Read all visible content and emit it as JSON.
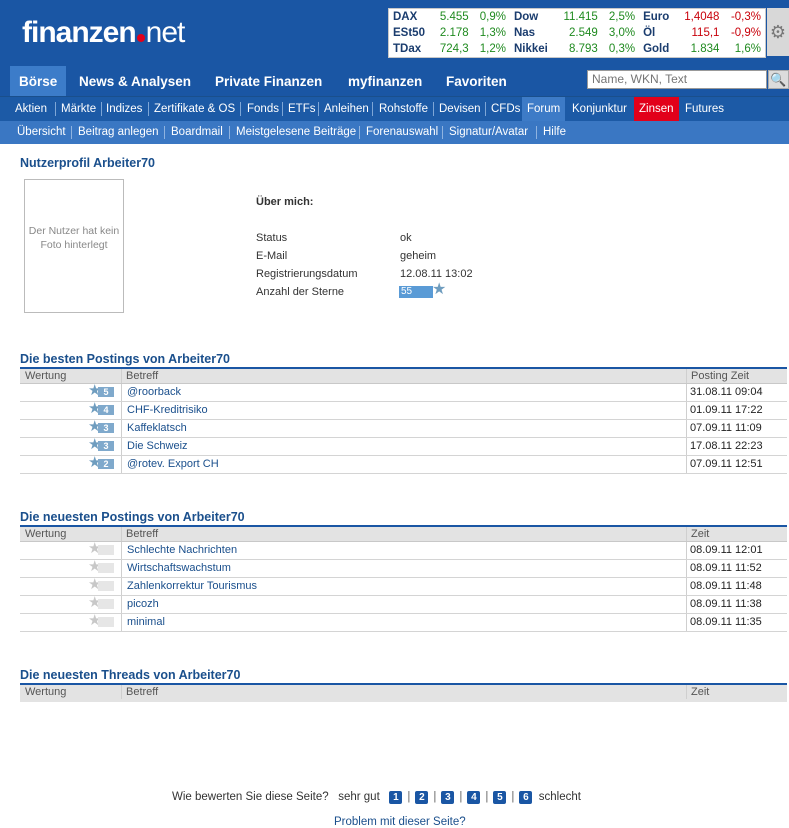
{
  "header": {
    "logo_main": "finanzen",
    "logo_suffix": "net",
    "ticker": [
      [
        {
          "n": "DAX",
          "v": "5.455",
          "p": "0,9%",
          "d": "up"
        },
        {
          "n": "Dow",
          "v": "11.415",
          "p": "2,5%",
          "d": "up"
        },
        {
          "n": "Euro",
          "v": "1,4048",
          "p": "-0,3%",
          "d": "down"
        }
      ],
      [
        {
          "n": "ESt50",
          "v": "2.178",
          "p": "1,3%",
          "d": "up"
        },
        {
          "n": "Nas",
          "v": "2.549",
          "p": "3,0%",
          "d": "up"
        },
        {
          "n": "Öl",
          "v": "115,1",
          "p": "-0,9%",
          "d": "down"
        }
      ],
      [
        {
          "n": "TDax",
          "v": "724,3",
          "p": "1,2%",
          "d": "up"
        },
        {
          "n": "Nikkei",
          "v": "8.793",
          "p": "0,3%",
          "d": "up"
        },
        {
          "n": "Gold",
          "v": "1.834",
          "p": "1,6%",
          "d": "up"
        }
      ]
    ],
    "settings_icon": "⚙"
  },
  "nav1": [
    "Börse",
    "News & Analysen",
    "Private Finanzen",
    "myfinanzen",
    "Favoriten"
  ],
  "search": {
    "placeholder": "Name, WKN, Text",
    "icon": "🔍"
  },
  "nav2": [
    "Aktien",
    "Märkte",
    "Indizes",
    "Zertifikate & OS",
    "Fonds",
    "ETFs",
    "Anleihen",
    "Rohstoffe",
    "Devisen",
    "CFDs",
    "Forum",
    "Konjunktur",
    "Zinsen",
    "Futures"
  ],
  "nav3": [
    "Übersicht",
    "Beitrag anlegen",
    "Boardmail",
    "Meistgelesene Beiträge",
    "Forenauswahl",
    "Signatur/Avatar",
    "Hilfe"
  ],
  "profile": {
    "title": "Nutzerprofil Arbeiter70",
    "photo_text": "Der Nutzer hat kein Foto hinterlegt",
    "about_label": "Über mich:",
    "fields": [
      {
        "label": "Status",
        "value": "ok"
      },
      {
        "label": "E-Mail",
        "value": "geheim"
      },
      {
        "label": "Registrierungsdatum",
        "value": "12.08.11 13:02"
      },
      {
        "label": "Anzahl der Sterne",
        "value": "55"
      }
    ]
  },
  "best": {
    "title": "Die besten Postings von Arbeiter70",
    "headers": [
      "Wertung",
      "Betreff",
      "Posting Zeit"
    ],
    "rows": [
      {
        "rating": "5",
        "subject": "@roorback",
        "time": "31.08.11 09:04"
      },
      {
        "rating": "4",
        "subject": "CHF-Kreditrisiko",
        "time": "01.09.11 17:22"
      },
      {
        "rating": "3",
        "subject": "Kaffeklatsch",
        "time": "07.09.11 11:09"
      },
      {
        "rating": "3",
        "subject": "Die Schweiz",
        "time": "17.08.11 22:23"
      },
      {
        "rating": "2",
        "subject": "@rotev. Export CH",
        "time": "07.09.11 12:51"
      }
    ]
  },
  "newest": {
    "title": "Die neuesten Postings von Arbeiter70",
    "headers": [
      "Wertung",
      "Betreff",
      "Zeit"
    ],
    "rows": [
      {
        "rating": "",
        "subject": "Schlechte Nachrichten",
        "time": "08.09.11 12:01"
      },
      {
        "rating": "",
        "subject": "Wirtschaftswachstum",
        "time": "08.09.11 11:52"
      },
      {
        "rating": "",
        "subject": "Zahlenkorrektur Tourismus",
        "time": "08.09.11 11:48"
      },
      {
        "rating": "",
        "subject": "picozh",
        "time": "08.09.11 11:38"
      },
      {
        "rating": "",
        "subject": "minimal",
        "time": "08.09.11 11:35"
      }
    ]
  },
  "threads": {
    "title": "Die neuesten Threads von Arbeiter70",
    "headers": [
      "Wertung",
      "Betreff",
      "Zeit"
    ]
  },
  "footer": {
    "rate_question": "Wie bewerten Sie diese Seite?",
    "good": "sehr gut",
    "bad": "schlecht",
    "scores": [
      "1",
      "2",
      "3",
      "4",
      "5",
      "6"
    ],
    "problem": "Problem mit dieser Seite?"
  },
  "colors": {
    "brand": "#1a56a4",
    "accent_red": "#e2001a",
    "link": "#1a4f8c"
  }
}
